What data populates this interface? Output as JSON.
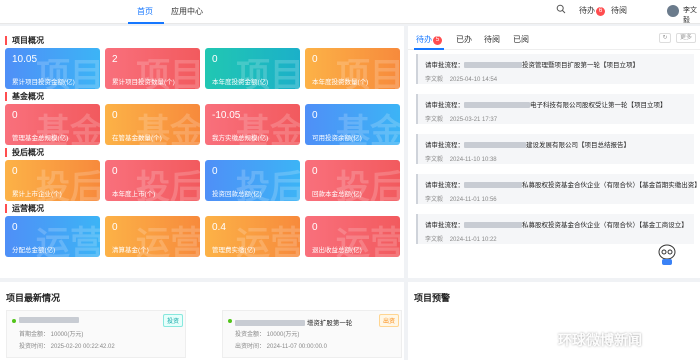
{
  "topnav": {
    "tabs": [
      "首页",
      "应用中心"
    ],
    "todo_label": "待办",
    "todo_count": "6",
    "read_label": "待阅",
    "user_name": "李文毅"
  },
  "sections": [
    {
      "title": "项目概况",
      "cards": [
        {
          "value": "10.05",
          "label": "累计项目投资金额(亿)",
          "color": "blue",
          "wm": "项目"
        },
        {
          "value": "2",
          "label": "累计项目投资数量(个)",
          "color": "red",
          "wm": "项目"
        },
        {
          "value": "0",
          "label": "本年度投资金额(亿)",
          "color": "teal",
          "wm": "项目"
        },
        {
          "value": "0",
          "label": "本年度投资数量(个)",
          "color": "orange",
          "wm": "项目"
        }
      ]
    },
    {
      "title": "基金概况",
      "cards": [
        {
          "value": "0",
          "label": "管理基金总规模(亿)",
          "color": "red",
          "wm": "基金"
        },
        {
          "value": "0",
          "label": "在管基金数量(个)",
          "color": "orange",
          "wm": "基金"
        },
        {
          "value": "-10.05",
          "label": "我方实缴总规模(亿)",
          "color": "red",
          "wm": "基金"
        },
        {
          "value": "0",
          "label": "可用投资余额(亿)",
          "color": "blue",
          "wm": "基金"
        }
      ]
    },
    {
      "title": "投后概况",
      "cards": [
        {
          "value": "0",
          "label": "累计上市企业(个)",
          "color": "orange",
          "wm": "投后"
        },
        {
          "value": "0",
          "label": "本年度上市(个)",
          "color": "red",
          "wm": "投后"
        },
        {
          "value": "0",
          "label": "投资回款总额(亿)",
          "color": "blue",
          "wm": "投后"
        },
        {
          "value": "0",
          "label": "回款本金总额(亿)",
          "color": "red",
          "wm": "投后"
        }
      ]
    },
    {
      "title": "运营概况",
      "cards": [
        {
          "value": "0",
          "label": "分配总金额(亿)",
          "color": "blue",
          "wm": "运营"
        },
        {
          "value": "0",
          "label": "清算基金(个)",
          "color": "orange",
          "wm": "运营"
        },
        {
          "value": "0.4",
          "label": "管理费实缴(亿)",
          "color": "orange",
          "wm": "运营"
        },
        {
          "value": "0",
          "label": "退出收益总额(亿)",
          "color": "red",
          "wm": "运营"
        }
      ]
    }
  ],
  "right_tabs": {
    "items": [
      "待办",
      "已办",
      "待阅",
      "已阅"
    ],
    "todo_count": "5",
    "more_label": "更多"
  },
  "todos": [
    {
      "prefix": "请审批流程：",
      "suffix": "投资管理暨项目扩股第一轮【项目立项】",
      "user": "李文毅",
      "date": "2025-04-10 14:54"
    },
    {
      "prefix": "请审批流程：",
      "suffix": "电子科技有限公司股权受让第一轮【项目立项】",
      "user": "李文毅",
      "date": "2025-03-21 17:37"
    },
    {
      "prefix": "请审批流程：",
      "suffix": "建设发展有限公司【项目总结报告】",
      "user": "李文毅",
      "date": "2024-11-10 10:38"
    },
    {
      "prefix": "请审批流程：",
      "suffix": "私募股权投资基金合伙企业（有限合伙）【基金首期实缴出资】",
      "user": "李文毅",
      "date": "2024-11-01 10:56"
    },
    {
      "prefix": "请审批流程：",
      "suffix": "私募股权投资基金合伙企业（有限合伙）【基金工商设立】",
      "user": "李文毅",
      "date": "2024-11-01 10:22"
    }
  ],
  "latest": {
    "title": "项目最新情况",
    "items": [
      {
        "tag": "投资",
        "amount": "首期金额：  10000(万元)",
        "time": "投资时间：  2025-02-20 00:22:42.02"
      },
      {
        "name": "增资扩股第一轮",
        "tag": "出资",
        "amount": "投资金额：  10000(万元)",
        "time": "出资时间：  2024-11-07 00:00:00.0"
      }
    ]
  },
  "warning": {
    "title": "项目预警"
  },
  "watermark": "环球微博新闻"
}
